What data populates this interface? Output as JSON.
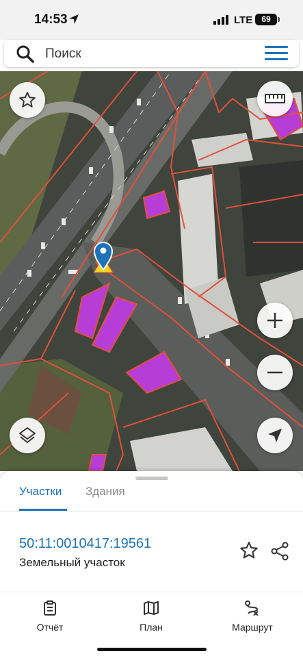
{
  "status_bar": {
    "time": "14:53",
    "network": "LTE",
    "battery": "69"
  },
  "search": {
    "placeholder": "Поиск"
  },
  "map": {
    "buttons": [
      "favorite-star",
      "ruler",
      "zoom-in",
      "zoom-out",
      "layers",
      "locate-me"
    ],
    "colors": {
      "parcel_border": "#e0503a",
      "building_fill": "#b63ed6",
      "marker": "#1e73b8",
      "marker_triangle": "#f2d21f"
    }
  },
  "sheet": {
    "tabs": [
      "Участки",
      "Здания"
    ],
    "active_tab": "Участки",
    "parcel": {
      "cadastral_number": "50:11:0010417:19561",
      "type": "Земельный участок"
    }
  },
  "bottom_nav": {
    "report": "Отчёт",
    "plan": "План",
    "route": "Маршрут"
  }
}
